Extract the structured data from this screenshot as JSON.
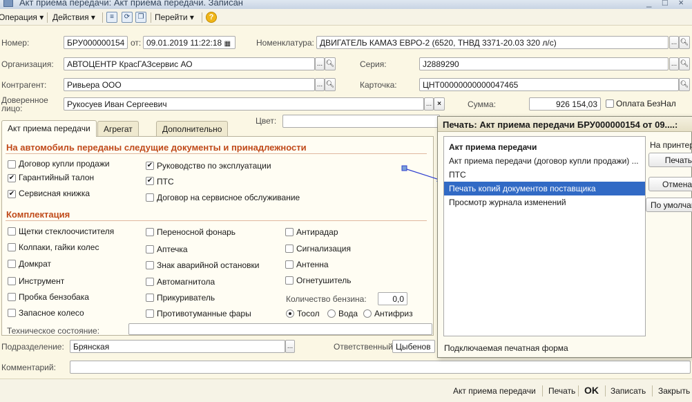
{
  "window": {
    "title": "Акт приема передачи: Акт приема передачи. Записан",
    "controls": "_ □ ×"
  },
  "toolbar": {
    "operation": "Операция ▾",
    "actions": "Действия ▾",
    "goto": "Перейти ▾",
    "help": "?"
  },
  "form": {
    "number_label": "Номер:",
    "number": "БРУ000000154",
    "from_label": "от:",
    "date": "09.01.2019 11:22:18",
    "nomenclature_label": "Номенклатура:",
    "nomenclature": "ДВИГАТЕЛЬ КАМАЗ ЕВРО-2 (6520, ТНВД 3371-20.03 320 л/с)",
    "org_label": "Организация:",
    "org": "АВТОЦЕНТР КрасГАЗсервис АО",
    "series_label": "Серия:",
    "series": "J2889290",
    "contractor_label": "Контрагент:",
    "contractor": "Ривьера ООО",
    "card_label": "Карточка:",
    "card": "ЦНТ00000000000047465",
    "trusted_label_1": "Доверенное",
    "trusted_label_2": "лицо:",
    "trusted": "Рукосуев Иван Сергеевич",
    "sum_label": "Сумма:",
    "sum": "926 154,03",
    "cashless_label": "Оплата БезНал",
    "color_label": "Цвет:"
  },
  "tabs": [
    "Акт приема передачи",
    "Агрегат",
    "Дополнительно"
  ],
  "docs": {
    "title": "На автомобиль переданы следущие документы и принадлежности",
    "col1": [
      {
        "label": "Договор купли продажи",
        "checked": false
      },
      {
        "label": "Гарантийный талон",
        "checked": true
      },
      {
        "label": "Сервисная книжка",
        "checked": true
      }
    ],
    "col2": [
      {
        "label": "Руководство по эксплуатации",
        "checked": true
      },
      {
        "label": "ПТС",
        "checked": true
      },
      {
        "label": "Договор на сервисное обслуживание",
        "checked": false
      }
    ]
  },
  "kit": {
    "title": "Комплектация",
    "col1": [
      "Щетки стеклоочистителя",
      "Колпаки, гайки колес",
      "Домкрат",
      "Инструмент",
      "Пробка бензобака",
      "Запасное колесо"
    ],
    "col2": [
      "Переносной фонарь",
      "Аптечка",
      "Знак аварийной остановки",
      "Автомагнитола",
      "Прикуриватель",
      "Противотуманные фары"
    ],
    "col3": [
      "Антирадар",
      "Сигнализация",
      "Антенна",
      "Огнетушитель"
    ],
    "fuel_label": "Количество бензина:",
    "fuel": "0,0",
    "radios": [
      {
        "label": "Тосол",
        "on": true
      },
      {
        "label": "Вода",
        "on": false
      },
      {
        "label": "Антифриз",
        "on": false
      }
    ],
    "tech_label": "Техническое состояние:"
  },
  "bottom": {
    "division_label": "Подразделение:",
    "division": "Брянская",
    "responsible_label": "Ответственный:",
    "responsible": "Цыбенов",
    "comment_label": "Комментарий:"
  },
  "popup": {
    "title": "Печать: Акт приема передачи БРУ000000154 от 09....:",
    "items": [
      "Акт приема передачи",
      "Акт приема передачи (договор купли продажи) ...",
      "ПТС",
      "Печать копий документов поставщика",
      "Просмотр журнала изменений"
    ],
    "selected_index": 3,
    "printer_label": "На принтер",
    "buttons": [
      "Печать",
      "Отмена",
      "По умолчанию"
    ],
    "footer": "Подключаемая печатная форма"
  },
  "footer": {
    "items": [
      "Акт приема передачи",
      "Печать",
      "OK",
      "Записать",
      "Закрыть"
    ]
  }
}
